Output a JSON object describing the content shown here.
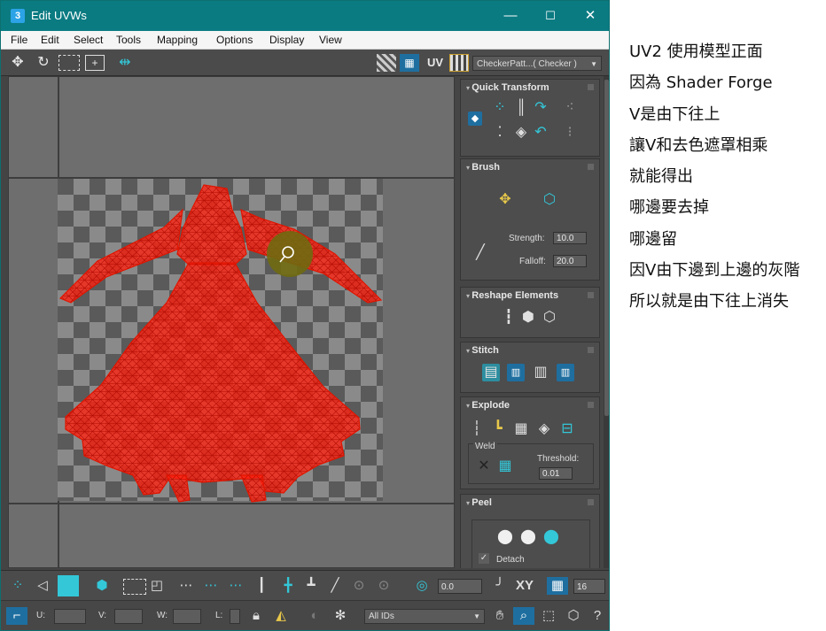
{
  "window": {
    "app_icon": "3",
    "title": "Edit UVWs",
    "controls": {
      "minimize": "—",
      "maximize": "☐",
      "close": "✕"
    }
  },
  "menu": [
    "File",
    "Edit",
    "Select",
    "Tools",
    "Mapping",
    "Options",
    "Display",
    "View"
  ],
  "toolbar": {
    "uv_label": "UV",
    "checker_dropdown": "CheckerPatt...( Checker )"
  },
  "panels": {
    "quick_transform": {
      "title": "Quick Transform"
    },
    "brush": {
      "title": "Brush",
      "strength_label": "Strength:",
      "strength_value": "10.0",
      "falloff_label": "Falloff:",
      "falloff_value": "20.0"
    },
    "reshape": {
      "title": "Reshape Elements"
    },
    "stitch": {
      "title": "Stitch"
    },
    "explode": {
      "title": "Explode",
      "weld_label": "Weld",
      "threshold_label": "Threshold:",
      "threshold_value": "0.01"
    },
    "peel": {
      "title": "Peel",
      "detach_label": "Detach"
    }
  },
  "bottom1": {
    "value1": "0.0",
    "xy_label": "XY",
    "value2": "16"
  },
  "bottom2": {
    "u_label": "U:",
    "v_label": "V:",
    "w_label": "W:",
    "l_label": "L:",
    "ids_dropdown": "All IDs"
  },
  "notes": [
    "UV2 使用模型正面",
    "因為 Shader Forge",
    "V是由下往上",
    "讓V和去色遮罩相乘",
    "就能得出",
    "哪邊要去掉",
    "哪邊留",
    "因V由下邊到上邊的灰階",
    "所以就是由下往上消失"
  ]
}
